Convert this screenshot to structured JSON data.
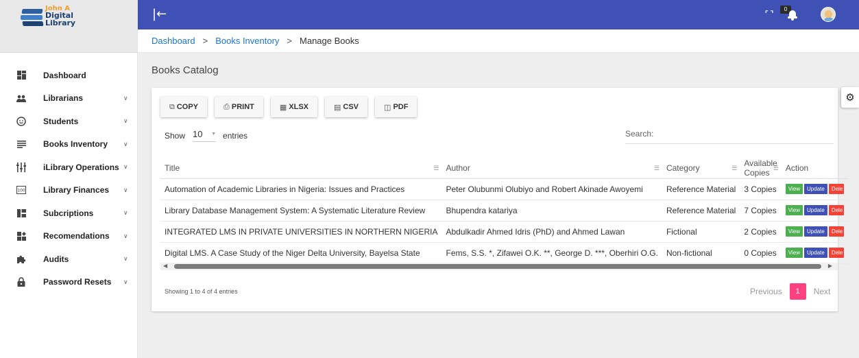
{
  "brand": {
    "line1": "John A",
    "line2": "Digital",
    "line3": "Library"
  },
  "sidebar": {
    "items": [
      {
        "label": "Dashboard",
        "icon": "dashboard-icon",
        "chevron": false
      },
      {
        "label": "Librarians",
        "icon": "people-icon",
        "chevron": true
      },
      {
        "label": "Students",
        "icon": "smiley-icon",
        "chevron": true
      },
      {
        "label": "Books Inventory",
        "icon": "list-icon",
        "chevron": true
      },
      {
        "label": "iLibrary Operations",
        "icon": "operations-icon",
        "chevron": true
      },
      {
        "label": "Library Finances",
        "icon": "finance-icon",
        "chevron": true
      },
      {
        "label": "Subcriptions",
        "icon": "subscriptions-icon",
        "chevron": true
      },
      {
        "label": "Recomendations",
        "icon": "recommendations-icon",
        "chevron": true
      },
      {
        "label": "Audits",
        "icon": "puzzle-icon",
        "chevron": true
      },
      {
        "label": "Password Resets",
        "icon": "lock-icon",
        "chevron": true
      }
    ]
  },
  "topbar": {
    "notifications_count": "0"
  },
  "breadcrumb": {
    "item1": "Dashboard",
    "item2": "Books Inventory",
    "current": "Manage Books"
  },
  "page": {
    "title": "Books Catalog"
  },
  "toolbar": {
    "copy": "COPY",
    "print": "PRINT",
    "xlsx": "XLSX",
    "csv": "CSV",
    "pdf": "PDF"
  },
  "controls": {
    "show_label": "Show",
    "entries_value": "10",
    "entries_label": "entries",
    "search_label": "Search:"
  },
  "table": {
    "headers": [
      "Title",
      "Author",
      "Category",
      "Available Copies",
      "Action"
    ],
    "rows": [
      [
        "Automation of Academic Libraries in Nigeria: Issues and Practices",
        "Peter Olubunmi Olubiyo and Robert Akinade Awoyemi",
        "Reference Material",
        "3 Copies"
      ],
      [
        "Library Database Management System: A Systematic Literature Review",
        "Bhupendra katariya",
        "Reference Material",
        "7 Copies"
      ],
      [
        "INTEGRATED LMS IN PRIVATE UNIVERSITIES IN NORTHERN NIGERIA",
        "Abdulkadir Ahmed Idris (PhD) and Ahmed Lawan",
        "Fictional",
        "2 Copies"
      ],
      [
        "Digital LMS. A Case Study of the Niger Delta University, Bayelsa State",
        "Fems, S.S. *, Zifawei O.K. **, George D. ***, Oberhiri O.G.",
        "Non-fictional",
        "0 Copies"
      ]
    ],
    "actions": {
      "view": "View",
      "update": "Update",
      "delete": "Dele"
    }
  },
  "footer": {
    "info": "Showing 1 to 4 of 4 entries",
    "previous": "Previous",
    "page": "1",
    "next": "Next"
  },
  "colors": {
    "primary": "#3f51b5",
    "accent": "#ff4081",
    "link": "#1976d2",
    "view": "#4caf50",
    "delete": "#f44336"
  }
}
